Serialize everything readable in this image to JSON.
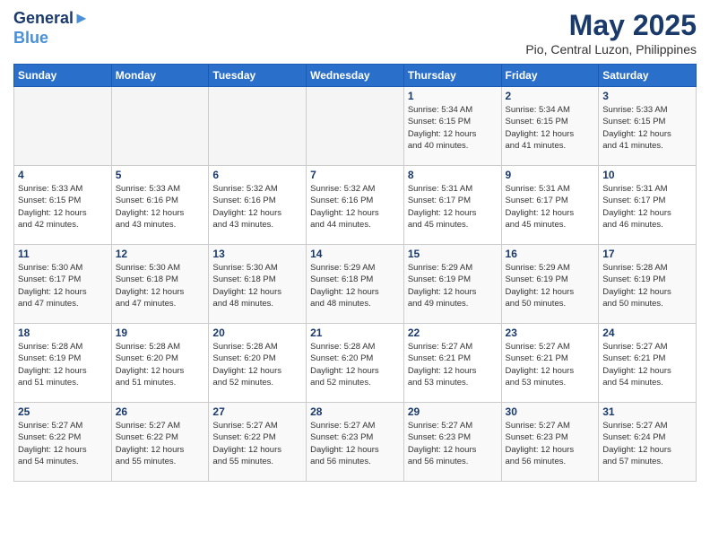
{
  "header": {
    "logo_line1": "General",
    "logo_line2": "Blue",
    "month": "May 2025",
    "location": "Pio, Central Luzon, Philippines"
  },
  "days_of_week": [
    "Sunday",
    "Monday",
    "Tuesday",
    "Wednesday",
    "Thursday",
    "Friday",
    "Saturday"
  ],
  "weeks": [
    [
      {
        "day": "",
        "info": ""
      },
      {
        "day": "",
        "info": ""
      },
      {
        "day": "",
        "info": ""
      },
      {
        "day": "",
        "info": ""
      },
      {
        "day": "1",
        "info": "Sunrise: 5:34 AM\nSunset: 6:15 PM\nDaylight: 12 hours\nand 40 minutes."
      },
      {
        "day": "2",
        "info": "Sunrise: 5:34 AM\nSunset: 6:15 PM\nDaylight: 12 hours\nand 41 minutes."
      },
      {
        "day": "3",
        "info": "Sunrise: 5:33 AM\nSunset: 6:15 PM\nDaylight: 12 hours\nand 41 minutes."
      }
    ],
    [
      {
        "day": "4",
        "info": "Sunrise: 5:33 AM\nSunset: 6:15 PM\nDaylight: 12 hours\nand 42 minutes."
      },
      {
        "day": "5",
        "info": "Sunrise: 5:33 AM\nSunset: 6:16 PM\nDaylight: 12 hours\nand 43 minutes."
      },
      {
        "day": "6",
        "info": "Sunrise: 5:32 AM\nSunset: 6:16 PM\nDaylight: 12 hours\nand 43 minutes."
      },
      {
        "day": "7",
        "info": "Sunrise: 5:32 AM\nSunset: 6:16 PM\nDaylight: 12 hours\nand 44 minutes."
      },
      {
        "day": "8",
        "info": "Sunrise: 5:31 AM\nSunset: 6:17 PM\nDaylight: 12 hours\nand 45 minutes."
      },
      {
        "day": "9",
        "info": "Sunrise: 5:31 AM\nSunset: 6:17 PM\nDaylight: 12 hours\nand 45 minutes."
      },
      {
        "day": "10",
        "info": "Sunrise: 5:31 AM\nSunset: 6:17 PM\nDaylight: 12 hours\nand 46 minutes."
      }
    ],
    [
      {
        "day": "11",
        "info": "Sunrise: 5:30 AM\nSunset: 6:17 PM\nDaylight: 12 hours\nand 47 minutes."
      },
      {
        "day": "12",
        "info": "Sunrise: 5:30 AM\nSunset: 6:18 PM\nDaylight: 12 hours\nand 47 minutes."
      },
      {
        "day": "13",
        "info": "Sunrise: 5:30 AM\nSunset: 6:18 PM\nDaylight: 12 hours\nand 48 minutes."
      },
      {
        "day": "14",
        "info": "Sunrise: 5:29 AM\nSunset: 6:18 PM\nDaylight: 12 hours\nand 48 minutes."
      },
      {
        "day": "15",
        "info": "Sunrise: 5:29 AM\nSunset: 6:19 PM\nDaylight: 12 hours\nand 49 minutes."
      },
      {
        "day": "16",
        "info": "Sunrise: 5:29 AM\nSunset: 6:19 PM\nDaylight: 12 hours\nand 50 minutes."
      },
      {
        "day": "17",
        "info": "Sunrise: 5:28 AM\nSunset: 6:19 PM\nDaylight: 12 hours\nand 50 minutes."
      }
    ],
    [
      {
        "day": "18",
        "info": "Sunrise: 5:28 AM\nSunset: 6:19 PM\nDaylight: 12 hours\nand 51 minutes."
      },
      {
        "day": "19",
        "info": "Sunrise: 5:28 AM\nSunset: 6:20 PM\nDaylight: 12 hours\nand 51 minutes."
      },
      {
        "day": "20",
        "info": "Sunrise: 5:28 AM\nSunset: 6:20 PM\nDaylight: 12 hours\nand 52 minutes."
      },
      {
        "day": "21",
        "info": "Sunrise: 5:28 AM\nSunset: 6:20 PM\nDaylight: 12 hours\nand 52 minutes."
      },
      {
        "day": "22",
        "info": "Sunrise: 5:27 AM\nSunset: 6:21 PM\nDaylight: 12 hours\nand 53 minutes."
      },
      {
        "day": "23",
        "info": "Sunrise: 5:27 AM\nSunset: 6:21 PM\nDaylight: 12 hours\nand 53 minutes."
      },
      {
        "day": "24",
        "info": "Sunrise: 5:27 AM\nSunset: 6:21 PM\nDaylight: 12 hours\nand 54 minutes."
      }
    ],
    [
      {
        "day": "25",
        "info": "Sunrise: 5:27 AM\nSunset: 6:22 PM\nDaylight: 12 hours\nand 54 minutes."
      },
      {
        "day": "26",
        "info": "Sunrise: 5:27 AM\nSunset: 6:22 PM\nDaylight: 12 hours\nand 55 minutes."
      },
      {
        "day": "27",
        "info": "Sunrise: 5:27 AM\nSunset: 6:22 PM\nDaylight: 12 hours\nand 55 minutes."
      },
      {
        "day": "28",
        "info": "Sunrise: 5:27 AM\nSunset: 6:23 PM\nDaylight: 12 hours\nand 56 minutes."
      },
      {
        "day": "29",
        "info": "Sunrise: 5:27 AM\nSunset: 6:23 PM\nDaylight: 12 hours\nand 56 minutes."
      },
      {
        "day": "30",
        "info": "Sunrise: 5:27 AM\nSunset: 6:23 PM\nDaylight: 12 hours\nand 56 minutes."
      },
      {
        "day": "31",
        "info": "Sunrise: 5:27 AM\nSunset: 6:24 PM\nDaylight: 12 hours\nand 57 minutes."
      }
    ]
  ]
}
